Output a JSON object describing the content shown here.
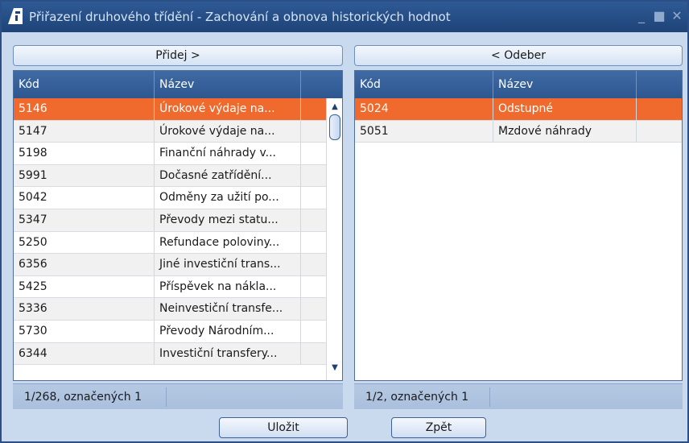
{
  "window": {
    "title": "Přiřazení druhového třídění - Zachování a obnova historických hodnot"
  },
  "actions": {
    "add_label": "Přidej  >",
    "remove_label": "<  Odeber"
  },
  "left_grid": {
    "headers": [
      "Kód",
      "Název"
    ],
    "rows": [
      {
        "kod": "5146",
        "nazev": "Úrokové výdaje na..."
      },
      {
        "kod": "5147",
        "nazev": "Úrokové výdaje na..."
      },
      {
        "kod": "5198",
        "nazev": "Finanční náhrady v..."
      },
      {
        "kod": "5991",
        "nazev": "Dočasné zatřídění..."
      },
      {
        "kod": "5042",
        "nazev": "Odměny za užití po..."
      },
      {
        "kod": "5347",
        "nazev": "Převody mezi statu..."
      },
      {
        "kod": "5250",
        "nazev": "Refundace poloviny..."
      },
      {
        "kod": "6356",
        "nazev": "Jiné investiční trans..."
      },
      {
        "kod": "5425",
        "nazev": "Příspěvek na nákla..."
      },
      {
        "kod": "5336",
        "nazev": "Neinvestiční transfe..."
      },
      {
        "kod": "5730",
        "nazev": "Převody Národním..."
      },
      {
        "kod": "6344",
        "nazev": "Investiční transfery..."
      }
    ],
    "status": "1/268, označených 1"
  },
  "right_grid": {
    "headers": [
      "Kód",
      "Název"
    ],
    "rows": [
      {
        "kod": "5024",
        "nazev": "Odstupné"
      },
      {
        "kod": "5051",
        "nazev": "Mzdové náhrady"
      }
    ],
    "status": "1/2, označených 1"
  },
  "footer": {
    "save_label": "Uložit",
    "back_label": "Zpět"
  },
  "colors": {
    "selected_row": "#f06a2e",
    "header": "#2e5790",
    "titlebar": "#1e4478"
  },
  "icons": [
    "app-logo",
    "minimize-icon",
    "maximize-icon",
    "close-icon",
    "scroll-up-icon",
    "scroll-down-icon"
  ]
}
